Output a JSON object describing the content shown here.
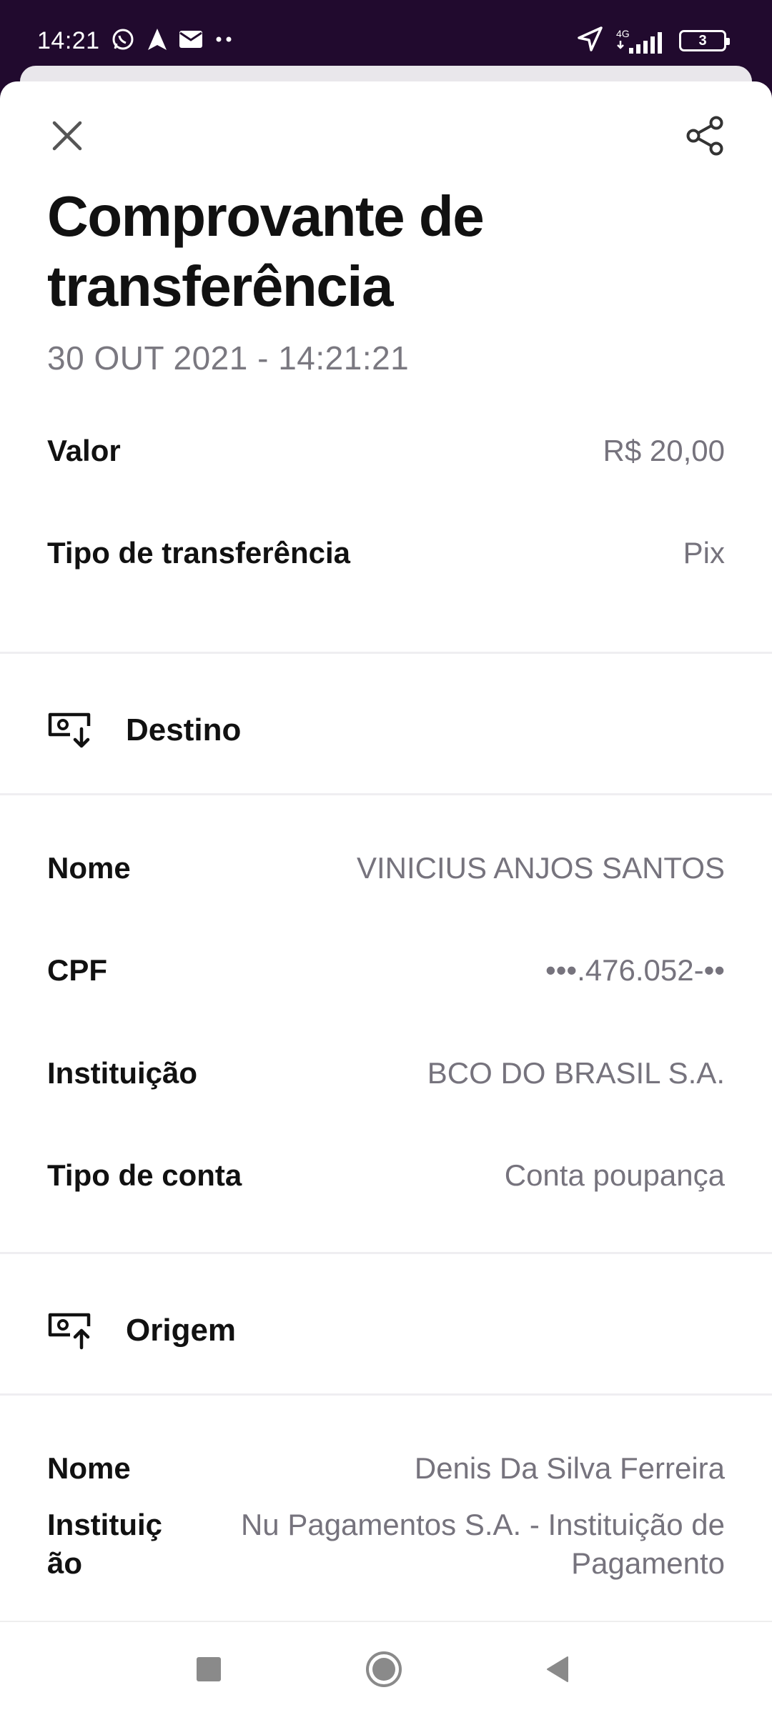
{
  "status_bar": {
    "time": "14:21",
    "network_label": "4G",
    "battery_level": "3",
    "icons": [
      "whatsapp-icon",
      "navigation-arrow-icon",
      "mail-icon",
      "more-dots-icon",
      "location-icon",
      "signal-icon",
      "battery-icon"
    ]
  },
  "header": {
    "title": "Comprovante de transferência",
    "date": "30 OUT 2021 - 14:21:21"
  },
  "summary": [
    {
      "label": "Valor",
      "value": "R$ 20,00"
    },
    {
      "label": "Tipo de transferência",
      "value": "Pix"
    }
  ],
  "destino": {
    "title": "Destino",
    "rows": [
      {
        "label": "Nome",
        "value": "VINICIUS ANJOS SANTOS"
      },
      {
        "label": "CPF",
        "value": "•••.476.052-••"
      },
      {
        "label": "Instituição",
        "value": "BCO DO BRASIL S.A."
      },
      {
        "label": "Tipo de conta",
        "value": "Conta poupança"
      }
    ]
  },
  "origem": {
    "title": "Origem",
    "rows": [
      {
        "label": "Nome",
        "value": "Denis Da Silva Ferreira"
      },
      {
        "label": "Instituição",
        "value": "Nu Pagamentos S.A. - Instituição de Pagamento"
      }
    ]
  },
  "colors": {
    "status_bar_bg": "#210a2e",
    "label_text": "#111111",
    "value_text": "#76737d",
    "divider": "#efeef1"
  }
}
